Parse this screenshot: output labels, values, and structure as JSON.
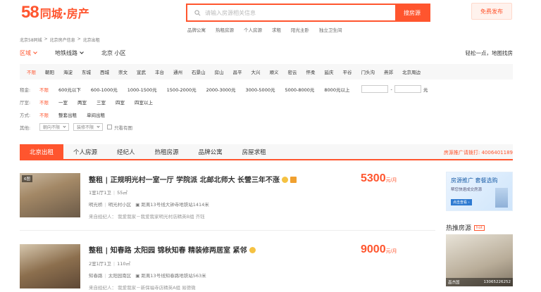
{
  "header": {
    "logo_num": "58",
    "logo_text": "同城·房产",
    "search_placeholder": "请输入房源相关信息",
    "search_button": "搜房源",
    "post_button": "免费发布",
    "quick_links": [
      "品牌公寓",
      "热租房源",
      "个人房源",
      "求租",
      "阳光主卧",
      "独立卫生间"
    ]
  },
  "breadcrumb": [
    "北京58同城",
    ">",
    "北京房产信息",
    ">",
    "北京出租"
  ],
  "filter_tabs": [
    {
      "label": "区域",
      "active": true
    },
    {
      "label": "地铁线路",
      "active": false
    },
    {
      "label": "北京 小区",
      "active": false
    }
  ],
  "map_find": "轻松一点，地图找房",
  "districts": [
    "不限",
    "朝阳",
    "海淀",
    "东城",
    "西城",
    "崇文",
    "宣武",
    "丰台",
    "通州",
    "石景山",
    "房山",
    "昌平",
    "大兴",
    "顺义",
    "密云",
    "怀柔",
    "延庆",
    "平谷",
    "门头沟",
    "燕郊",
    "北京周边"
  ],
  "rent_filter": {
    "label": "租金:",
    "options": [
      "不限",
      "600元以下",
      "600-1000元",
      "1000-1500元",
      "1500-2000元",
      "2000-3000元",
      "3000-5000元",
      "5000-8000元",
      "8000元以上"
    ],
    "dash": "-",
    "unit": "元"
  },
  "room_filter": {
    "label": "厅室:",
    "options": [
      "不限",
      "一室",
      "两室",
      "三室",
      "四室",
      "四室以上"
    ]
  },
  "mode_filter": {
    "label": "方式:",
    "options": [
      "不限",
      "整套出租",
      "单间出租"
    ]
  },
  "other_filter": {
    "label": "其他:",
    "dropdowns": [
      "朝向不限",
      "装修不限"
    ],
    "checkbox": "只看有图"
  },
  "main_tabs": [
    "北京出租",
    "个人房源",
    "经纪人",
    "热租房源",
    "品牌公寓",
    "房屋求租"
  ],
  "hotline": "房源推广请拨打: 4006401189",
  "listings": [
    {
      "badge": "6图",
      "title": "整租 | 正规明光村一室一厅 学院派 北邮北师大 长營三年不涨",
      "room": "1室1厅1卫",
      "area": "55㎡",
      "district": "明光桥",
      "community": "明光村小区",
      "distance": "距离13号线大钟寺地铁站1414米",
      "agent": "来自经纪人：  我爱我家－我爱我家明光村店精英B组    齐钰",
      "price": "5300",
      "unit": "元/月"
    },
    {
      "badge": "",
      "title": "整租 | 知春路 太阳园 锦秋知春 精装修两居室 紧邻",
      "room": "2室1厅1卫",
      "area": "110㎡",
      "district": "知春路",
      "community": "太阳园南区",
      "distance": "距离13号线知春路地铁站563米",
      "agent": "来自经纪人：  我爱我家－新保福寺店精英A组    易德微",
      "price": "9000",
      "unit": "元/月"
    }
  ],
  "ad": {
    "title": "房源推广 套餐选购",
    "sub": "帮您快速成交房源",
    "more": "点击查看 ›"
  },
  "hot_rec": {
    "title": "热推房源",
    "tag": "hot",
    "name": "昌杰国",
    "phone": "13065226252"
  }
}
